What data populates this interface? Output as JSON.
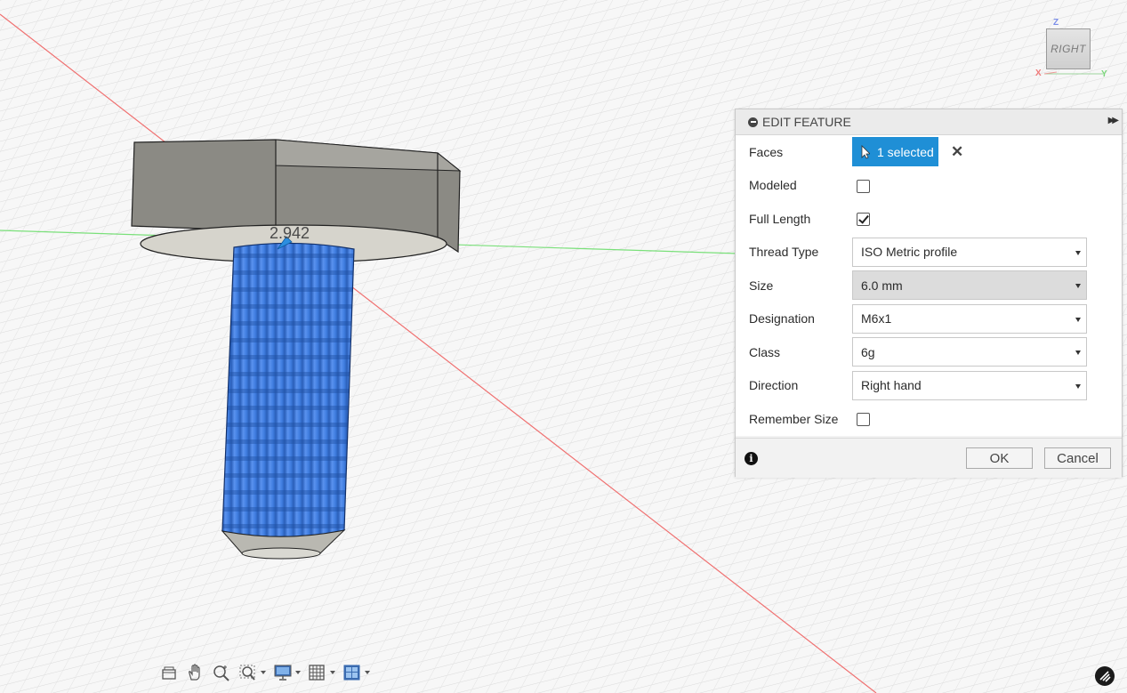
{
  "viewport": {
    "dimension_value": "2.942",
    "view_cube": {
      "face_label": "RIGHT",
      "axis_z": "Z",
      "axis_x": "X",
      "axis_y": "Y"
    },
    "colors": {
      "thread_blue": "#3f7de0",
      "axis_red": "#f07070",
      "axis_green": "#7ae07a",
      "grid": "#d9d9d9"
    }
  },
  "panel": {
    "title": "EDIT FEATURE",
    "rows": {
      "faces": {
        "label": "Faces",
        "value": "1 selected"
      },
      "modeled": {
        "label": "Modeled",
        "checked": false
      },
      "full_length": {
        "label": "Full Length",
        "checked": true
      },
      "thread_type": {
        "label": "Thread Type",
        "value": "ISO Metric profile"
      },
      "size": {
        "label": "Size",
        "value": "6.0 mm"
      },
      "designation": {
        "label": "Designation",
        "value": "M6x1"
      },
      "class": {
        "label": "Class",
        "value": "6g"
      },
      "direction": {
        "label": "Direction",
        "value": "Right hand"
      },
      "remember_size": {
        "label": "Remember Size",
        "checked": false
      }
    },
    "ok_label": "OK",
    "cancel_label": "Cancel"
  },
  "toolbar": {
    "icons": [
      "camera-icon",
      "pan-hand-icon",
      "zoom-icon",
      "zoom-window-icon",
      "display-settings-icon",
      "grid-settings-icon",
      "viewports-icon"
    ]
  }
}
